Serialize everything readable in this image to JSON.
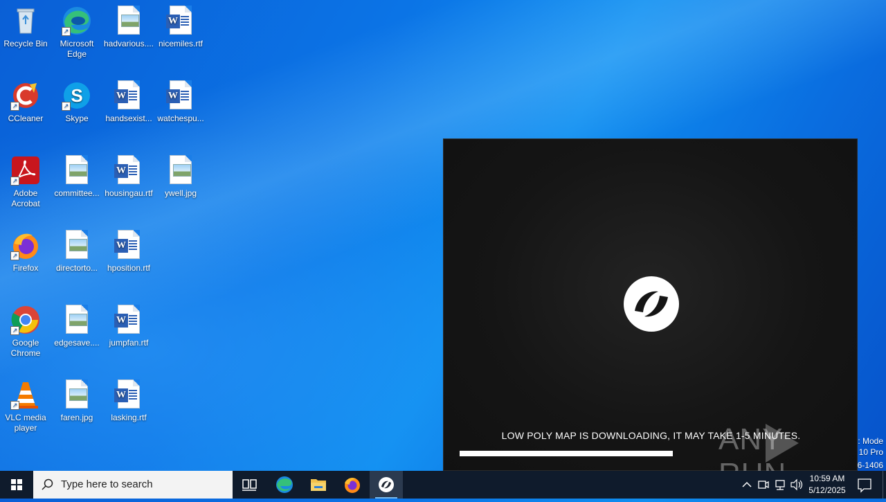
{
  "desktop": {
    "icons": [
      {
        "label": "Recycle Bin"
      },
      {
        "label": "Microsoft Edge"
      },
      {
        "label": "hadvarious...."
      },
      {
        "label": "nicemiles.rtf"
      },
      {
        "label": "CCleaner"
      },
      {
        "label": "Skype"
      },
      {
        "label": "handsexist..."
      },
      {
        "label": "watchespu..."
      },
      {
        "label": "Adobe Acrobat"
      },
      {
        "label": "committee..."
      },
      {
        "label": "housingau.rtf"
      },
      {
        "label": "ywell.jpg"
      },
      {
        "label": "Firefox"
      },
      {
        "label": "directorto..."
      },
      {
        "label": "hposition.rtf"
      },
      {
        "label": "Google Chrome"
      },
      {
        "label": "edgesave...."
      },
      {
        "label": "jumpfan.rtf"
      },
      {
        "label": "VLC media player"
      },
      {
        "label": "faren.jpg"
      },
      {
        "label": "lasking.rtf"
      }
    ],
    "windows_info": {
      "line1": ": Mode",
      "line2": "10 Pro",
      "line3": "6-1406"
    }
  },
  "game_window": {
    "loading_text": "LOW POLY MAP IS DOWNLOADING, IT MAY TAKE 1-5 MINUTES.",
    "progress_percent": 56,
    "logo_icon": "game-logo-icon"
  },
  "watermark": {
    "text_left": "ANY",
    "text_right": "RUN"
  },
  "taskbar": {
    "search_placeholder": "Type here to search",
    "clock_time": "10:59 AM",
    "clock_date": "5/12/2025",
    "accent_color": "#76b9ed"
  }
}
